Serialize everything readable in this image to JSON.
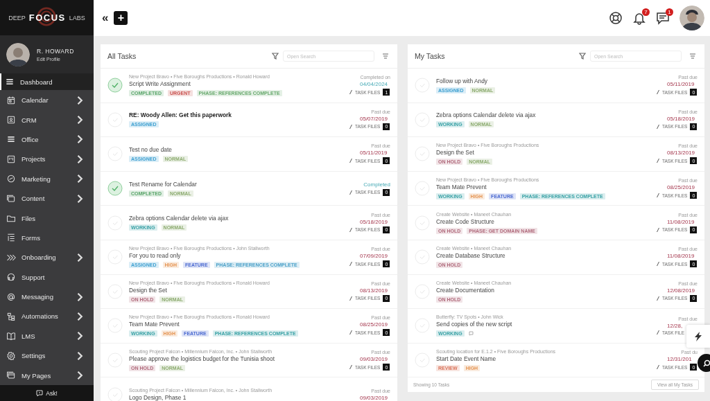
{
  "logo": {
    "left": "DEEP",
    "center": "FOCUS",
    "right": "LABS"
  },
  "profile": {
    "name": "R. HOWARD",
    "link": "Edit Profile"
  },
  "sidebar": {
    "items": [
      {
        "label": "Dashboard",
        "selected": true,
        "submenu": false
      },
      {
        "label": "Calendar",
        "selected": false,
        "submenu": true
      },
      {
        "label": "CRM",
        "selected": false,
        "submenu": true
      },
      {
        "label": "Office",
        "selected": false,
        "submenu": true
      },
      {
        "label": "Projects",
        "selected": false,
        "submenu": true
      },
      {
        "label": "Marketing",
        "selected": false,
        "submenu": true
      },
      {
        "label": "Content",
        "selected": false,
        "submenu": true
      },
      {
        "label": "Files",
        "selected": false,
        "submenu": false
      },
      {
        "label": "Forms",
        "selected": false,
        "submenu": false
      },
      {
        "label": "Onboarding",
        "selected": false,
        "submenu": true
      },
      {
        "label": "Support",
        "selected": false,
        "submenu": false
      },
      {
        "label": "Messaging",
        "selected": false,
        "submenu": true
      },
      {
        "label": "Automations",
        "selected": false,
        "submenu": true
      },
      {
        "label": "LMS",
        "selected": false,
        "submenu": true
      },
      {
        "label": "Settings",
        "selected": false,
        "submenu": true
      },
      {
        "label": "My Pages",
        "selected": false,
        "submenu": true
      }
    ],
    "ask": "Ask!"
  },
  "topbar": {
    "collapse": "«",
    "add": "+",
    "notifications_badge": "7",
    "messages_badge": "1"
  },
  "panels": [
    {
      "title": "All Tasks",
      "search": {
        "placeholder": "Open Search"
      },
      "tasks": [
        {
          "meta": "New Project Bravo • Five Boroughs Productions • Ronald Howard",
          "title": "Script Write Assignment",
          "unread": false,
          "done": true,
          "note": false,
          "tags": [
            {
              "label": "COMPLETED",
              "color": "#5aa56a"
            },
            {
              "label": "URGENT",
              "color": "#c9524f"
            },
            {
              "label": "PHASE: REFERENCES COMPLETE",
              "color": "#6aaa6f"
            }
          ],
          "overdue": false,
          "due_label": "Completed on",
          "due_date": "04/04/2024",
          "files_label": "TASK FILES",
          "files": "1"
        },
        {
          "title": "RE: Woody Allen: Get this paperwork",
          "unread": true,
          "done": false,
          "note": false,
          "tags": [
            {
              "label": "ASSIGNED",
              "color": "#3c9fd0"
            }
          ],
          "overdue": true,
          "due_label": "Past due",
          "due_date": "05/07/2019",
          "files_label": "TASK FILES",
          "files": "0"
        },
        {
          "title": "Test no due date",
          "unread": false,
          "done": false,
          "note": false,
          "tags": [
            {
              "label": "ASSIGNED",
              "color": "#3c9fd0"
            },
            {
              "label": "NORMAL",
              "color": "#8cab6f"
            }
          ],
          "overdue": true,
          "due_label": "Past due",
          "due_date": "05/11/2019",
          "files_label": "TASK FILES",
          "files": "0"
        },
        {
          "title": "Test Rename for Calendar",
          "unread": false,
          "done": true,
          "note": false,
          "tags": [
            {
              "label": "COMPLETED",
              "color": "#5aa56a"
            },
            {
              "label": "NORMAL",
              "color": "#8cab6f"
            }
          ],
          "overdue": false,
          "due_label": "Completed",
          "files_label": "TASK FILES",
          "files": "0"
        },
        {
          "title": "Zebra options Calendar delete via ajax",
          "unread": false,
          "done": false,
          "note": false,
          "tags": [
            {
              "label": "WORKING",
              "color": "#3aa2a6"
            },
            {
              "label": "NORMAL",
              "color": "#8cab6f"
            }
          ],
          "overdue": true,
          "due_label": "Past due",
          "due_date": "05/18/2019",
          "files_label": "TASK FILES",
          "files": "0"
        },
        {
          "meta": "New Project Bravo • Five Boroughs Productions • John Stallworth",
          "title": "For you to read only",
          "unread": false,
          "done": false,
          "note": false,
          "tags": [
            {
              "label": "ASSIGNED",
              "color": "#3c9fd0"
            },
            {
              "label": "HIGH",
              "color": "#e59452"
            },
            {
              "label": "FEATURE",
              "color": "#4c6bd1"
            },
            {
              "label": "PHASE: REFERENCES COMPLETE",
              "color": "#4aa0c8"
            }
          ],
          "overdue": true,
          "due_label": "Past due",
          "due_date": "07/09/2019",
          "files_label": "TASK FILES",
          "files": "0"
        },
        {
          "meta": "New Project Bravo • Five Boroughs Productions • Ronald Howard",
          "title": "Design the Set",
          "unread": false,
          "done": false,
          "note": false,
          "tags": [
            {
              "label": "ON HOLD",
              "color": "#b06a7c"
            },
            {
              "label": "NORMAL",
              "color": "#8cab6f"
            }
          ],
          "overdue": true,
          "due_label": "Past due",
          "due_date": "08/13/2019",
          "files_label": "TASK FILES",
          "files": "0"
        },
        {
          "meta": "New Project Bravo • Five Boroughs Productions • Ronald Howard",
          "title": "Team Mate Prevent",
          "unread": false,
          "done": false,
          "note": false,
          "tags": [
            {
              "label": "WORKING",
              "color": "#3aa2a6"
            },
            {
              "label": "HIGH",
              "color": "#e59452"
            },
            {
              "label": "FEATURE",
              "color": "#4c6bd1"
            },
            {
              "label": "PHASE: REFERENCES COMPLETE",
              "color": "#3aa2a6"
            }
          ],
          "overdue": true,
          "due_label": "Past due",
          "due_date": "08/25/2019",
          "files_label": "TASK FILES",
          "files": "0"
        },
        {
          "meta": "Scouting Project Falcon • Millennium Falcon, Inc. • John Stallworth",
          "title": "Please approve the logistics budget for the Tunisia shoot",
          "unread": false,
          "done": false,
          "note": false,
          "tags": [
            {
              "label": "ON HOLD",
              "color": "#b06a7c"
            },
            {
              "label": "NORMAL",
              "color": "#8cab6f"
            }
          ],
          "overdue": true,
          "due_label": "Past due",
          "due_date": "09/03/2019",
          "files_label": "TASK FILES",
          "files": "0"
        },
        {
          "meta": "Scouting Project Falcon • Millennium Falcon, Inc. • John Stallworth",
          "title": "Logo Design, Phase 1",
          "unread": false,
          "done": false,
          "note": false,
          "overdue": true,
          "due_label": "Past due",
          "due_date": "09/03/2019"
        }
      ]
    },
    {
      "title": "My Tasks",
      "search": {
        "placeholder": "Open Search"
      },
      "tasks": [
        {
          "title": "Follow up with Andy",
          "unread": false,
          "done": false,
          "note": false,
          "tags": [
            {
              "label": "ASSIGNED",
              "color": "#3c9fd0"
            },
            {
              "label": "NORMAL",
              "color": "#8cab6f"
            }
          ],
          "overdue": true,
          "due_label": "Past due",
          "due_date": "05/11/2019",
          "files_label": "TASK FILES",
          "files": "0"
        },
        {
          "title": "Zebra options Calendar delete via ajax",
          "unread": false,
          "done": false,
          "note": false,
          "tags": [
            {
              "label": "WORKING",
              "color": "#3aa2a6"
            },
            {
              "label": "NORMAL",
              "color": "#8cab6f"
            }
          ],
          "overdue": true,
          "due_label": "Past due",
          "due_date": "05/18/2019",
          "files_label": "TASK FILES",
          "files": "0"
        },
        {
          "meta": "New Project Bravo • Five Boroughs Productions",
          "title": "Design the Set",
          "unread": false,
          "done": false,
          "note": false,
          "tags": [
            {
              "label": "ON HOLD",
              "color": "#b06a7c"
            },
            {
              "label": "NORMAL",
              "color": "#8cab6f"
            }
          ],
          "overdue": true,
          "due_label": "Past due",
          "due_date": "08/13/2019",
          "files_label": "TASK FILES",
          "files": "0"
        },
        {
          "meta": "New Project Bravo • Five Boroughs Productions",
          "title": "Team Mate Prevent",
          "unread": false,
          "done": false,
          "note": false,
          "tags": [
            {
              "label": "WORKING",
              "color": "#3aa2a6"
            },
            {
              "label": "HIGH",
              "color": "#e59452"
            },
            {
              "label": "FEATURE",
              "color": "#4c6bd1"
            },
            {
              "label": "PHASE: REFERENCES COMPLETE",
              "color": "#3aa2a6"
            }
          ],
          "overdue": true,
          "due_label": "Past due",
          "due_date": "08/25/2019",
          "files_label": "TASK FILES",
          "files": "0"
        },
        {
          "meta": "Create Website • Maneet Chauhan",
          "title": "Create Code Structure",
          "unread": false,
          "done": false,
          "note": false,
          "tags": [
            {
              "label": "ON HOLD",
              "color": "#b06a7c"
            },
            {
              "label": "PHASE: GET DOMAIN NAME",
              "color": "#b06a7c"
            }
          ],
          "overdue": true,
          "due_label": "Past due",
          "due_date": "11/08/2019",
          "files_label": "TASK FILES",
          "files": "0"
        },
        {
          "meta": "Create Website • Maneet Chauhan",
          "title": "Create Database Structure",
          "unread": false,
          "done": false,
          "note": false,
          "tags": [
            {
              "label": "ON HOLD",
              "color": "#b06a7c"
            }
          ],
          "overdue": true,
          "due_label": "Past due",
          "due_date": "11/08/2019",
          "files_label": "TASK FILES",
          "files": "0"
        },
        {
          "meta": "Create Website • Maneet Chauhan",
          "title": "Create Documentation",
          "unread": false,
          "done": false,
          "note": false,
          "tags": [
            {
              "label": "ON HOLD",
              "color": "#b06a7c"
            }
          ],
          "overdue": true,
          "due_label": "Past due",
          "due_date": "12/08/2019",
          "files_label": "TASK FILES",
          "files": "0"
        },
        {
          "meta": "Butterfly: TV Spots • John Wick",
          "title": "Send copies of the new script",
          "unread": false,
          "done": false,
          "note": true,
          "tags": [
            {
              "label": "WORKING",
              "color": "#3aa2a6"
            }
          ],
          "overdue": true,
          "due_label": "Past due",
          "due_date": "12/28,",
          "files_label": "TASK FILE"
        },
        {
          "meta": "Scouting location for E.1.2 • Five Boroughs Productions",
          "title": "Start Date Event Name",
          "unread": false,
          "done": false,
          "note": false,
          "tags": [
            {
              "label": "REVIEW",
              "color": "#d9735a"
            },
            {
              "label": "HIGH",
              "color": "#e59452"
            }
          ],
          "overdue": true,
          "due_label": "Past du",
          "due_date": "12/31/201",
          "files_label": "TASK FILES",
          "files": "0"
        }
      ],
      "footer": {
        "showing": "Showing 10 Tasks",
        "button": "View all My Tasks"
      }
    }
  ]
}
